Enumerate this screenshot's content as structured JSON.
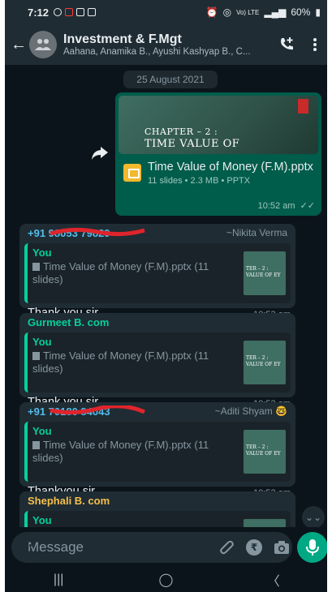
{
  "status": {
    "time": "7:12",
    "right": "60%",
    "net": "Vo) LTE"
  },
  "header": {
    "title": "Investment & F.Mgt",
    "subtitle": "Aahana, Anamika B., Ayushi Kashyap B., C..."
  },
  "chat": {
    "date": "25 August 2021",
    "outgoing": {
      "thumb_line1": "CHAPTER – 2 :",
      "thumb_line2": "TIME VALUE OF",
      "doc_name": "Time Value of Money (F.M).pptx",
      "doc_meta": "11 slides • 2.3 MB • PPTX",
      "time": "10:52 am"
    },
    "incoming": [
      {
        "sender": "+91 98053 79829",
        "sender_color": "#53bdeb",
        "aside": "~Nikita Verma",
        "quote_name": "You",
        "quote_text": "Time Value of Money (F.M).pptx (11 slides)",
        "thumb_text": "TER – 2 : VALUE OF EY",
        "text": "Thank you sir.",
        "time": "10:53 am"
      },
      {
        "sender": "Gurmeet B. com",
        "sender_color": "#06cf9c",
        "aside": "",
        "quote_name": "You",
        "quote_text": "Time Value of Money (F.M).pptx (11 slides)",
        "thumb_text": "TER – 2 : VALUE OF EY",
        "text": "Thank you sir",
        "time": "10:53 am"
      },
      {
        "sender": "+91 70180 84043",
        "sender_color": "#53bdeb",
        "aside": "~Aditi Shyam 🤓",
        "quote_name": "You",
        "quote_text": "Time Value of Money (F.M).pptx (11 slides)",
        "thumb_text": "TER – 2 : VALUE OF EY",
        "text": "Thankyou  sir",
        "time": "10:53 am"
      },
      {
        "sender": "Shephali B. com",
        "sender_color": "#f5c04d",
        "aside": "",
        "quote_name": "You",
        "quote_text": "",
        "thumb_text": "",
        "text": "",
        "time": ""
      }
    ]
  },
  "composer": {
    "placeholder": "Message"
  },
  "colors": {
    "accent": "#00a884",
    "background": "#0b141a",
    "bar": "#1f2c34"
  }
}
